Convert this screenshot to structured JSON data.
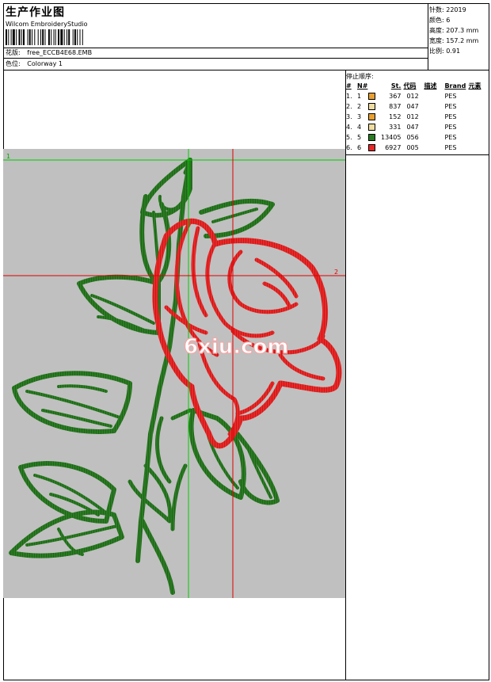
{
  "header": {
    "title": "生产作业图",
    "software": "Wilcom EmbroideryStudio",
    "design_label": "花版:",
    "design_value": "free_ECCB4E68.EMB",
    "colorway_label": "色位:",
    "colorway_value": "Colorway 1"
  },
  "stats": {
    "stitches_label": "针数:",
    "stitches_value": "22019",
    "colors_label": "颜色:",
    "colors_value": "6",
    "height_label": "高度:",
    "height_value": "207.3 mm",
    "width_label": "宽度:",
    "width_value": "157.2 mm",
    "scale_label": "比例:",
    "scale_value": "0.91"
  },
  "legend": {
    "title": "停止顺序:",
    "columns": [
      "#",
      "N#",
      "St.",
      "代码",
      "描述",
      "Brand",
      "元素"
    ],
    "rows": [
      {
        "num": "1.",
        "n": "1",
        "color": "#e8a030",
        "st": "367",
        "code": "012",
        "brand": "PES"
      },
      {
        "num": "2.",
        "n": "2",
        "color": "#f0dca0",
        "st": "837",
        "code": "047",
        "brand": "PES"
      },
      {
        "num": "3.",
        "n": "3",
        "color": "#e8a030",
        "st": "152",
        "code": "012",
        "brand": "PES"
      },
      {
        "num": "4.",
        "n": "4",
        "color": "#f0dca0",
        "st": "331",
        "code": "047",
        "brand": "PES"
      },
      {
        "num": "5.",
        "n": "5",
        "color": "#2a7a22",
        "st": "13405",
        "code": "056",
        "brand": "PES"
      },
      {
        "num": "6.",
        "n": "6",
        "color": "#e82828",
        "st": "6927",
        "code": "005",
        "brand": "PES"
      }
    ]
  },
  "canvas": {
    "guide_h1": "1",
    "guide_h2": "2",
    "watermark": "6xiu.com",
    "leaf_color": "#2a7a22",
    "rose_color": "#e82828"
  }
}
